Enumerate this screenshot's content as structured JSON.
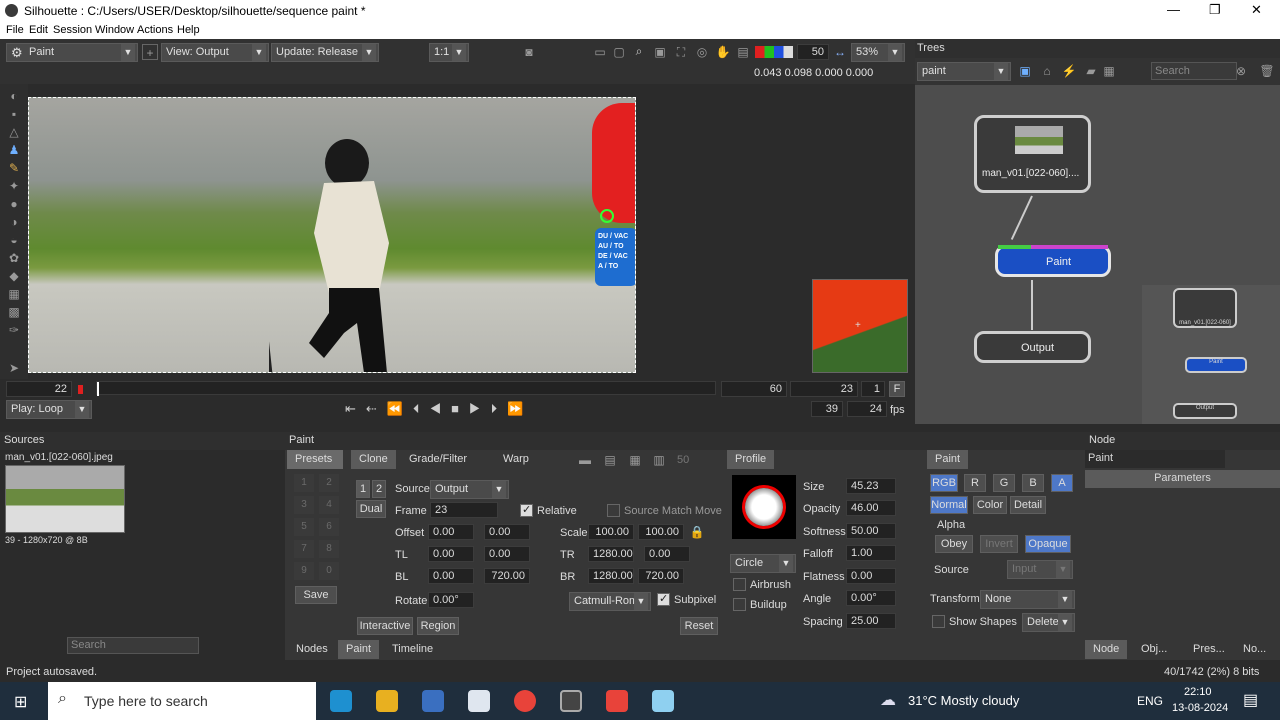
{
  "window": {
    "title": "Silhouette : C:/Users/USER/Desktop/silhouette/sequence paint *",
    "min": "—",
    "max": "❐",
    "close": "✕"
  },
  "menu": [
    "File",
    "Edit",
    "Session",
    "Window",
    "Actions",
    "Help"
  ],
  "toolbar": {
    "mode": "Paint",
    "view": "View: Output",
    "update": "Update: Release",
    "ratio": "1:1",
    "exposure": "50",
    "zoom": "53%",
    "readout": "0.043 0.098 0.000 0.000"
  },
  "timeline": {
    "frame": "22",
    "end": "60",
    "current": "23",
    "step": "1",
    "f_label": "F",
    "play_mode": "Play: Loop",
    "duration": "39",
    "fps": "24",
    "fps_label": "fps"
  },
  "viewer": {
    "sign_text": "DU / VAC AU / TO DE / VAC A / TO"
  },
  "trees": {
    "title": "Trees",
    "tree_select": "paint",
    "search_placeholder": "Search",
    "nodes": {
      "source": "man_v01.[022-060]....",
      "paint": "Paint",
      "output": "Output"
    },
    "mini_source": "man_v01.[022-060]",
    "mini_paint": "Paint",
    "mini_output": "Output"
  },
  "sources": {
    "title": "Sources",
    "file": "man_v01.[022-060].jpeg",
    "info": "39 - 1280x720 @ 8B",
    "search_placeholder": "Search"
  },
  "paint": {
    "title": "Paint",
    "tabs": {
      "presets": "Presets",
      "clone": "Clone",
      "grade": "Grade/Filter",
      "warp": "Warp",
      "profile": "Profile",
      "paint": "Paint"
    },
    "clone": {
      "n1": "1",
      "n2": "2",
      "source_label": "Source",
      "source": "Output",
      "dual": "Dual",
      "frame_label": "Frame",
      "frame": "23",
      "relative": "Relative",
      "source_match": "Source Match Move",
      "offset_label": "Offset",
      "offset_x": "0.00",
      "offset_y": "0.00",
      "scale_label": "Scale",
      "scale_x": "100.00",
      "scale_y": "100.00",
      "tl_label": "TL",
      "tl_x": "0.00",
      "tl_y": "0.00",
      "tr_label": "TR",
      "tr_x": "1280.00",
      "tr_y": "0.00",
      "bl_label": "BL",
      "bl_x": "0.00",
      "bl_y": "720.00",
      "br_label": "BR",
      "br_x": "1280.00",
      "br_y": "720.00",
      "rotate_label": "Rotate",
      "rotate": "0.00°",
      "filter": "Catmull-Rom",
      "subpixel": "Subpixel",
      "interactive": "Interactive",
      "region": "Region",
      "reset": "Reset",
      "save": "Save",
      "slider_val": "50",
      "grid": [
        "1",
        "2",
        "3",
        "4",
        "5",
        "6",
        "7",
        "8",
        "9",
        "0"
      ]
    },
    "profile": {
      "shape": "Circle",
      "airbrush": "Airbrush",
      "buildup": "Buildup"
    },
    "params": {
      "size_label": "Size",
      "size": "45.23",
      "opacity_label": "Opacity",
      "opacity": "46.00",
      "softness_label": "Softness",
      "softness": "50.00",
      "falloff_label": "Falloff",
      "falloff": "1.00",
      "flatness_label": "Flatness",
      "flatness": "0.00",
      "angle_label": "Angle",
      "angle": "0.00°",
      "spacing_label": "Spacing",
      "spacing": "25.00"
    },
    "channels": {
      "rgb": "RGB",
      "r": "R",
      "g": "G",
      "b": "B",
      "a": "A",
      "normal": "Normal",
      "color": "Color",
      "detail": "Detail",
      "alpha": "Alpha",
      "obey": "Obey",
      "invert": "Invert",
      "opaque": "Opaque",
      "source_label": "Source",
      "source": "Input",
      "transform_label": "Transform",
      "transform": "None",
      "show_shapes": "Show Shapes",
      "delete": "Delete"
    }
  },
  "bottom_tabs": [
    "Nodes",
    "Paint",
    "Timeline"
  ],
  "node_panel": {
    "title": "Node",
    "name": "Paint",
    "params": "Parameters",
    "tabs": [
      "Node",
      "Obj...",
      "Pres...",
      "No..."
    ],
    "status": "40/1742 (2%) 8 bits"
  },
  "status": {
    "msg": "Project autosaved."
  },
  "taskbar": {
    "search": "Type here to search",
    "weather": "31°C  Mostly cloudy",
    "lang": "ENG",
    "time": "22:10",
    "date": "13-08-2024"
  },
  "colors": {
    "accent_blue": "#2f7fe0",
    "paint_node": "#1a4fc4",
    "clone_tab": "#5b5b5b"
  }
}
